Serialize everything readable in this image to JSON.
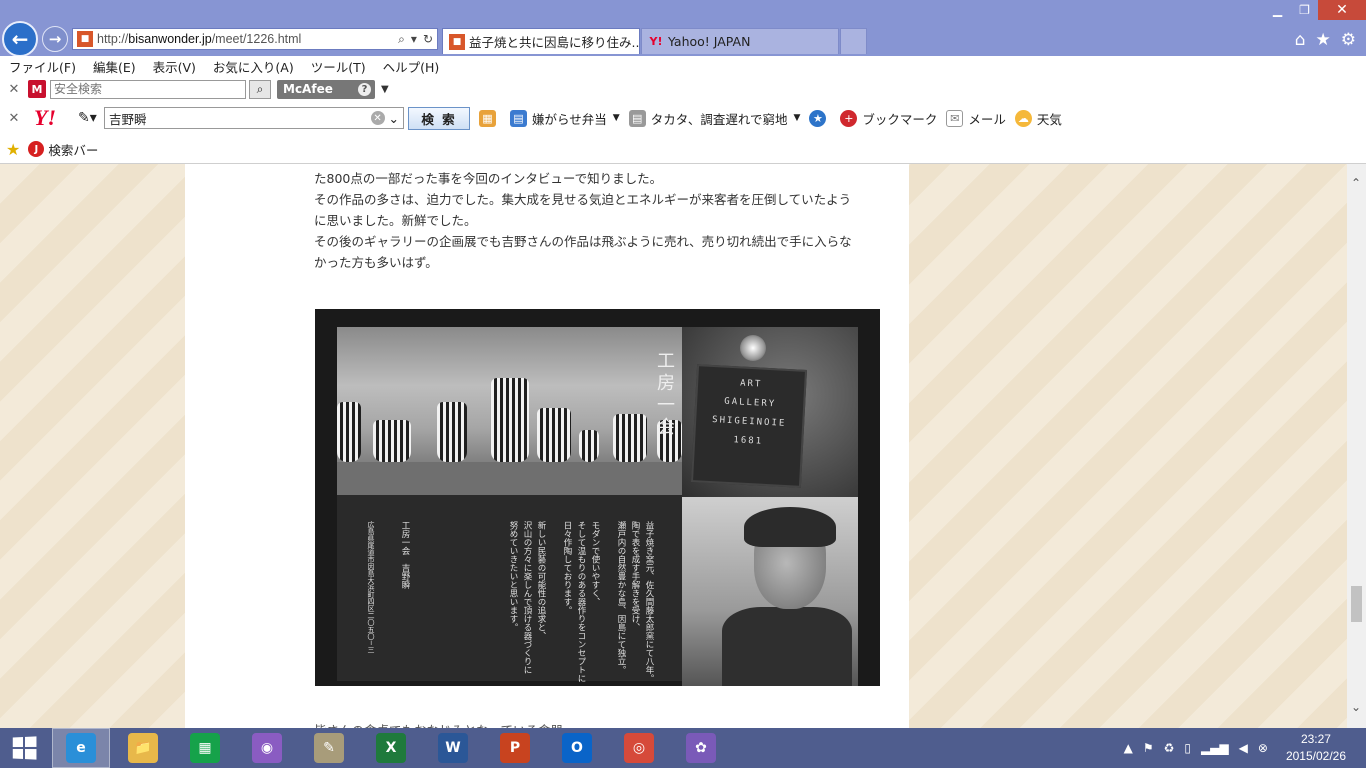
{
  "browser": {
    "address": {
      "url_prefix": "http://",
      "url_domain": "bisanwonder.jp",
      "url_path": "/meet/1226.html"
    },
    "tabs": [
      {
        "title": "益子焼と共に因島に移り住み...",
        "icon": "site-favicon"
      },
      {
        "title": "Yahoo! JAPAN",
        "icon": "yahoo-favicon"
      }
    ],
    "window_controls": {
      "minimize": "▁",
      "restore": "❐",
      "close": "✕"
    }
  },
  "menubar": {
    "items": [
      "ファイル(F)",
      "編集(E)",
      "表示(V)",
      "お気に入り(A)",
      "ツール(T)",
      "ヘルプ(H)"
    ]
  },
  "mcafee_toolbar": {
    "search_placeholder": "安全検索",
    "brand": "McAfee"
  },
  "yahoo_toolbar": {
    "search_value": "吉野瞬",
    "search_button": "検 索",
    "links": [
      {
        "label": "嫌がらせ弁当",
        "icon": "news-icon",
        "dropdown": true
      },
      {
        "label": "タカタ、調査遅れで窮地",
        "icon": "page-icon",
        "dropdown": true
      },
      {
        "label": "ブックマーク",
        "icon": "bookmark-icon",
        "dropdown": false
      },
      {
        "label": "メール",
        "icon": "mail-icon",
        "dropdown": false
      },
      {
        "label": "天気",
        "icon": "weather-icon",
        "dropdown": false
      }
    ]
  },
  "favorites_bar": {
    "item": "検索バー"
  },
  "article": {
    "lines": [
      "た800点の一部だった事を今回のインタビューで知りました。",
      "その作品の多さは、迫力でした。集大成を見せる気迫とエネルギーが来客者を圧倒していたよう",
      "に思いました。新鮮でした。",
      "その後のギャラリーの企画展でも吉野さんの作品は飛ぶように売れ、売り切れ続出で手に入らな",
      "かった方も多いはず。"
    ],
    "photo": {
      "kobo_title": "工房一会",
      "sign_lines": [
        "ART",
        "GALLERY",
        "SHIGEINOIE",
        "1681"
      ],
      "vertical_text": [
        "益子焼き窯元、佐久間藤太郎窯にて八年。",
        "陶で表を成す手解きを受け、",
        "瀬戸内の自然豊かな島、因島にて独立。",
        "",
        "モダンで使いやすく、",
        "そして温もりのある器作りをコンセプトに",
        "日々作陶しております。",
        "",
        "新しい民藝の可能性の追求と、",
        "沢山の方々に楽しんで頂ける器づくりに",
        "努めていきたいと思います。",
        "",
        "",
        "工房一会　吉野瞬",
        "",
        "広島県尾道市因島大浜町四区二〇五〇−三"
      ]
    },
    "next_text": "皆さんの食卓でもおなじみとなっている食器"
  },
  "taskbar": {
    "apps": [
      {
        "name": "internet-explorer",
        "label": "e",
        "color": "#2a8fd8",
        "active": true
      },
      {
        "name": "file-explorer",
        "label": "📁",
        "color": "#e8b84a",
        "active": false
      },
      {
        "name": "store",
        "label": "▦",
        "color": "#16a24a",
        "active": false
      },
      {
        "name": "media-app",
        "label": "◉",
        "color": "#8a5cc2",
        "active": false
      },
      {
        "name": "notepad-app",
        "label": "✎",
        "color": "#a89c7a",
        "active": false
      },
      {
        "name": "excel",
        "label": "X",
        "color": "#1f7a3c",
        "active": false
      },
      {
        "name": "word",
        "label": "W",
        "color": "#2b5797",
        "active": false
      },
      {
        "name": "powerpoint",
        "label": "P",
        "color": "#c8431f",
        "active": false
      },
      {
        "name": "outlook",
        "label": "O",
        "color": "#0a64c8",
        "active": false
      },
      {
        "name": "chrome",
        "label": "◎",
        "color": "#d64a3a",
        "active": false
      },
      {
        "name": "picasa",
        "label": "✿",
        "color": "#7a5ab8",
        "active": false
      }
    ],
    "time": "23:27",
    "date": "2015/02/26"
  }
}
